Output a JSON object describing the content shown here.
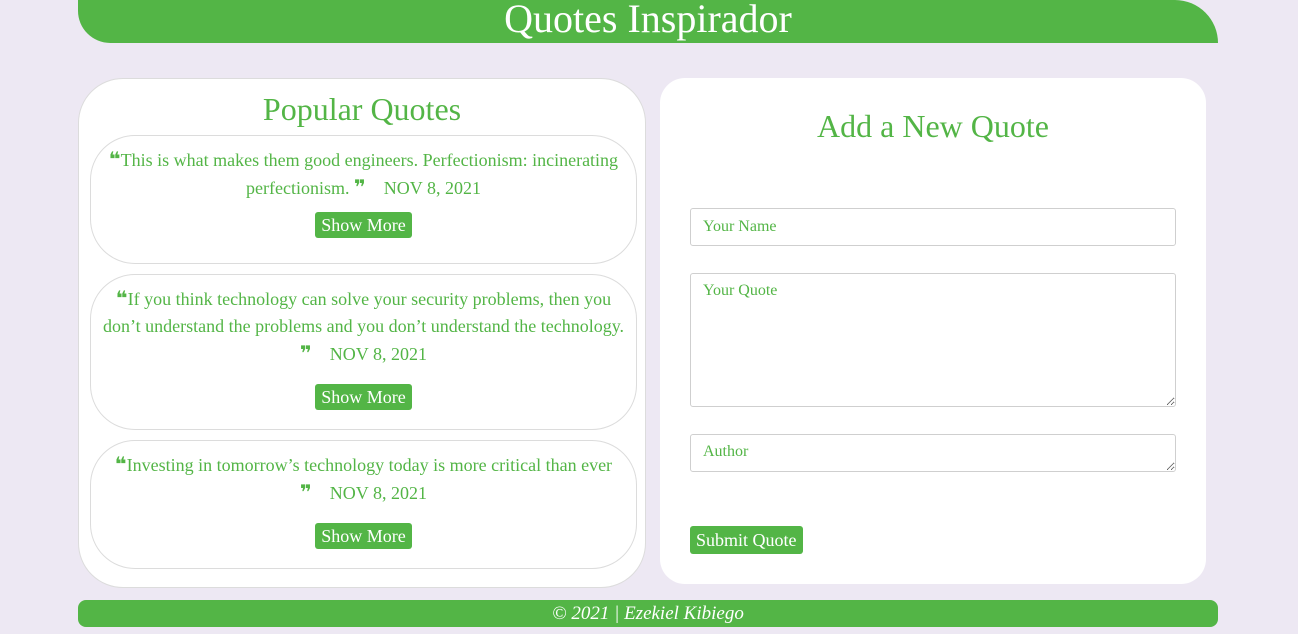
{
  "header": {
    "title": "Quotes Inspirador"
  },
  "popular": {
    "heading": "Popular Quotes",
    "open_quote_glyph": "❝",
    "close_quote_glyph": "❞",
    "quotes": [
      {
        "text": "This is what makes them good engineers. Perfectionism: incinerating perfectionism.",
        "date": "NOV 8, 2021",
        "button": "Show More"
      },
      {
        "text": "If you think technology can solve your security problems, then you don’t understand the problems and you don’t understand the technology.",
        "date": "NOV 8, 2021",
        "button": "Show More"
      },
      {
        "text": "Investing in tomorrow’s technology today is more critical than ever",
        "date": "NOV 8, 2021",
        "button": "Show More"
      }
    ]
  },
  "form": {
    "heading": "Add a New Quote",
    "name_placeholder": "Your Name",
    "quote_placeholder": "Your Quote",
    "author_placeholder": "Author",
    "submit_label": "Submit Quote"
  },
  "footer": {
    "text": "© 2021 | Ezekiel Kibiego"
  },
  "colors": {
    "accent": "#53b546",
    "background": "#ede8f3",
    "panel": "#ffffff"
  }
}
